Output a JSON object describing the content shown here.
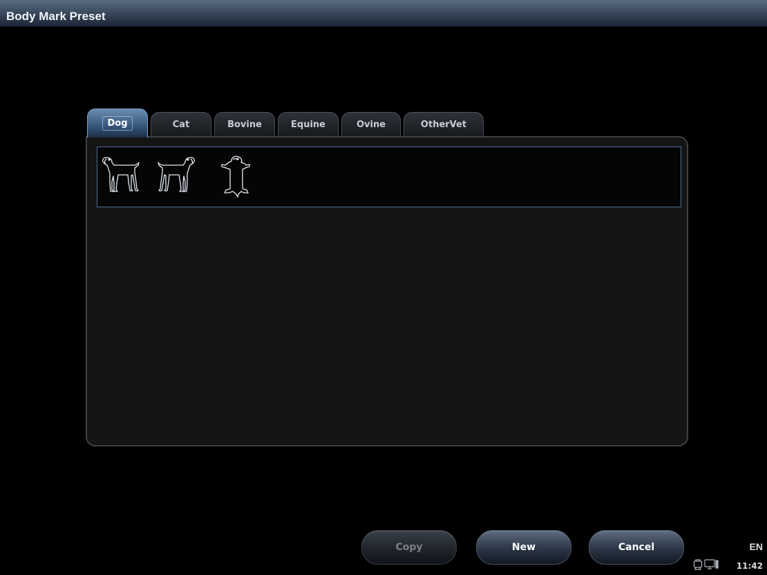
{
  "window": {
    "title": "Body Mark Preset"
  },
  "tabs": [
    {
      "label": "Dog",
      "active": true
    },
    {
      "label": "Cat",
      "active": false
    },
    {
      "label": "Bovine",
      "active": false
    },
    {
      "label": "Equine",
      "active": false
    },
    {
      "label": "Ovine",
      "active": false
    },
    {
      "label": "OtherVet",
      "active": false
    }
  ],
  "body_marks": [
    {
      "icon": "dog-standing-left-icon"
    },
    {
      "icon": "dog-standing-right-icon"
    },
    {
      "icon": "dog-supine-icon"
    }
  ],
  "buttons": {
    "copy_label": "Copy",
    "new_label": "New",
    "cancel_label": "Cancel"
  },
  "status": {
    "language": "EN",
    "time": "11:42",
    "icons": [
      "printer-icon",
      "monitor-icon"
    ]
  },
  "colors": {
    "active_tab": "#3b5b82",
    "title_bar": "#3c4b60",
    "selection_border": "#4f6f9a"
  }
}
